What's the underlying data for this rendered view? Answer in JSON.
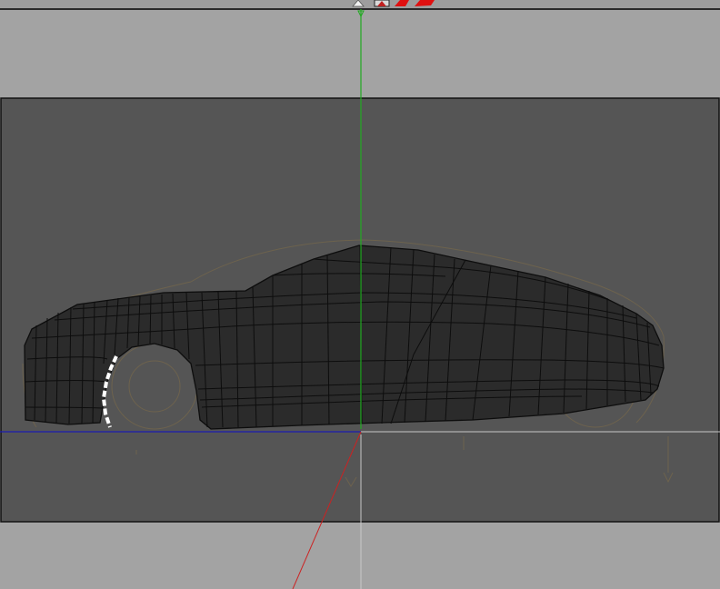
{
  "viewport": {
    "view": "side-orthographic",
    "colors": {
      "background": "#a3a3a3",
      "backplate": "#555555",
      "model_fill": "#2b2b2b",
      "wire": "#0d0d0d",
      "y_axis": "#22aa22",
      "x_axis": "#1c1cb0",
      "z_axis": "#cc2222",
      "selection": "#ffffff",
      "sketch": "#7a6a4a"
    }
  },
  "toolbar": {
    "tools": [
      {
        "name": "view-white-icon",
        "color": "#f0f0f0"
      },
      {
        "name": "view-selected-icon",
        "color": "#d8d8d8"
      },
      {
        "name": "view-red-icon",
        "color": "#e01010"
      },
      {
        "name": "view-red-2-icon",
        "color": "#e01010"
      }
    ]
  }
}
